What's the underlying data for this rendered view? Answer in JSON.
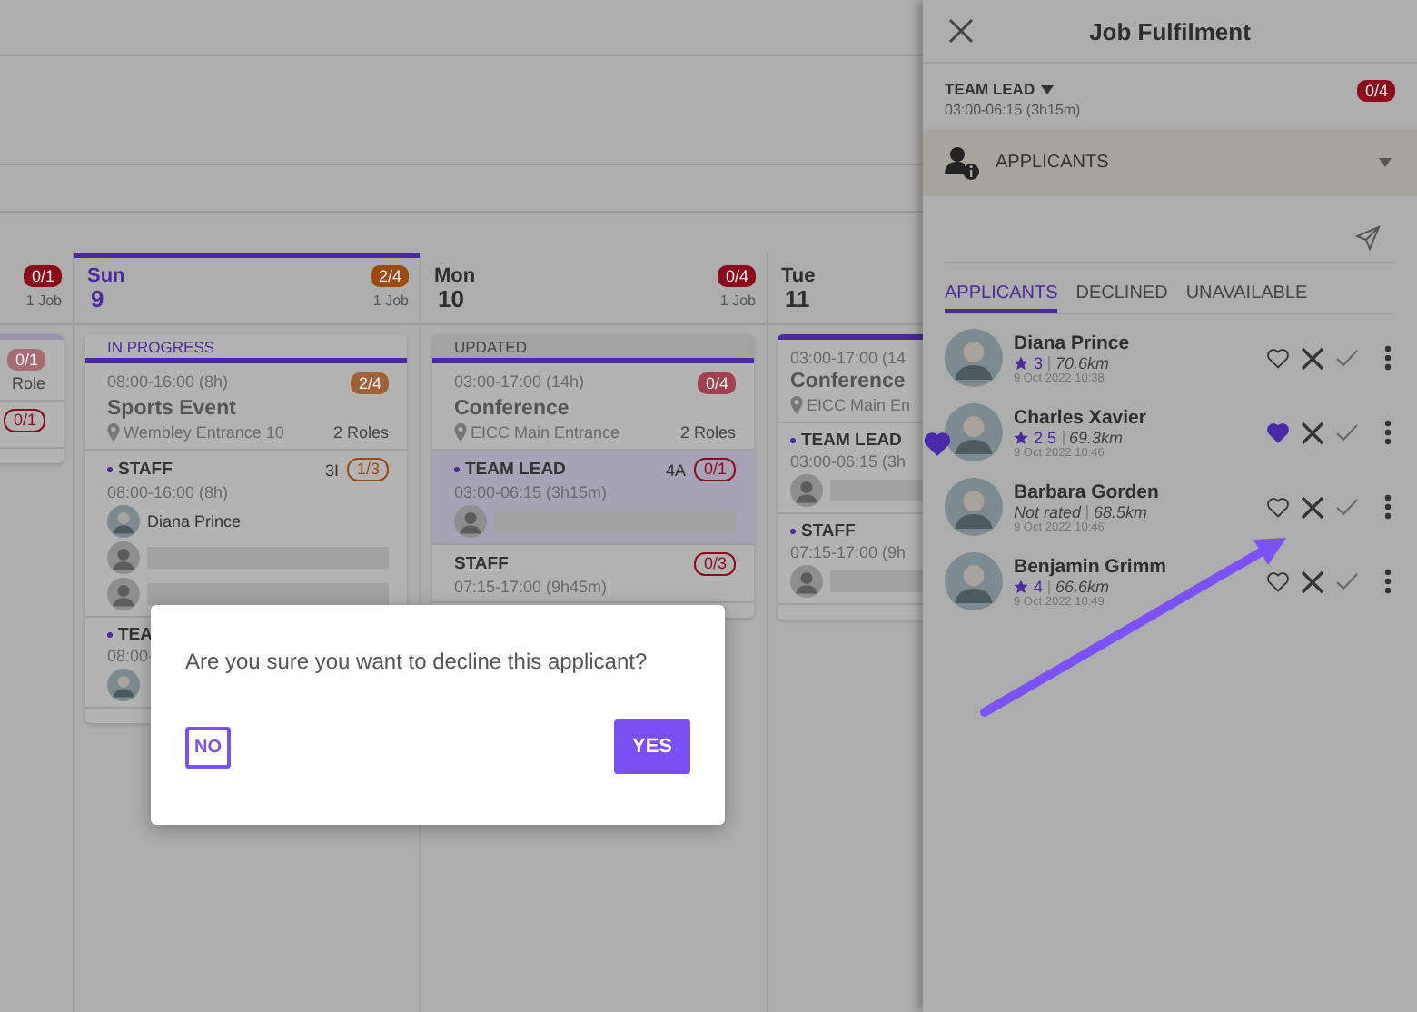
{
  "calendar": {
    "days": [
      {
        "badge": {
          "text": "0/1",
          "color": "#8c0a1a"
        },
        "jobs": "1 Job",
        "selected": false,
        "cards": [
          {
            "status": {
              "kind": "faded"
            },
            "badge": {
              "text": "0/1",
              "color": "#a86b74"
            },
            "roles_count": "Role",
            "roles": [
              {
                "selected": false,
                "badge": {
                  "text": "0/1",
                  "color": "#8c0a1a"
                },
                "slots": [
                  {
                    "kind": "bar"
                  }
                ]
              }
            ]
          }
        ]
      },
      {
        "weekday": "Sun",
        "day": "9",
        "badge": {
          "text": "2/4",
          "color": "#9c4a12"
        },
        "jobs": "1 Job",
        "selected": true,
        "cards": [
          {
            "status": {
              "kind": "progress",
              "text": "IN PROGRESS"
            },
            "time": "08:00-16:00 (8h)",
            "badge": {
              "text": "2/4",
              "color": "#a0603a"
            },
            "title": "Sports Event",
            "location": "Wembley Entrance 10",
            "roles_count": "2 Roles",
            "roles": [
              {
                "name": "STAFF",
                "marked": true,
                "selected": false,
                "code": "3I",
                "badge": {
                  "text": "1/3",
                  "color": "#9c4a12"
                },
                "time": "08:00-16:00 (8h)",
                "slots": [
                  {
                    "kind": "filled",
                    "name": "Diana Prince"
                  },
                  {
                    "kind": "empty"
                  },
                  {
                    "kind": "empty"
                  }
                ]
              },
              {
                "name": "TEA",
                "marked": true,
                "selected": false,
                "time": "08:00-",
                "slots": [
                  {
                    "kind": "filled"
                  }
                ]
              }
            ]
          }
        ]
      },
      {
        "weekday": "Mon",
        "day": "10",
        "badge": {
          "text": "0/4",
          "color": "#8c0a1a"
        },
        "jobs": "1 Job",
        "selected": false,
        "cards": [
          {
            "status": {
              "kind": "updated",
              "text": "UPDATED"
            },
            "time": "03:00-17:00 (14h)",
            "badge": {
              "text": "0/4",
              "color": "#a0414f"
            },
            "title": "Conference",
            "location": "EICC Main Entrance",
            "roles_count": "2 Roles",
            "roles": [
              {
                "name": "TEAM LEAD",
                "marked": true,
                "selected": true,
                "code": "4A",
                "badge": {
                  "text": "0/1",
                  "color": "#8c0a1a"
                },
                "time": "03:00-06:15 (3h15m)",
                "slots": [
                  {
                    "kind": "empty"
                  }
                ]
              },
              {
                "name": "STAFF",
                "marked": false,
                "selected": false,
                "badge": {
                  "text": "0/3",
                  "color": "#8c0a1a"
                },
                "time": "07:15-17:00 (9h45m)"
              }
            ]
          }
        ]
      },
      {
        "weekday": "Tue",
        "day": "11",
        "selected": false,
        "cards": [
          {
            "status": {
              "kind": "plain"
            },
            "time": "03:00-17:00 (14",
            "title": "Conference",
            "location": "EICC Main En",
            "roles": [
              {
                "name": "TEAM LEAD",
                "marked": true,
                "selected": false,
                "time": "03:00-06:15 (3h",
                "slots": [
                  {
                    "kind": "empty"
                  }
                ]
              },
              {
                "name": "STAFF",
                "marked": true,
                "selected": false,
                "time": "07:15-17:00 (9h",
                "slots": [
                  {
                    "kind": "empty"
                  }
                ]
              }
            ]
          }
        ]
      }
    ]
  },
  "panel": {
    "title": "Job Fulfilment",
    "role": {
      "name": "TEAM LEAD",
      "time": "03:00-06:15 (3h15m)",
      "badge": {
        "text": "0/4",
        "color": "#8c0a1a"
      }
    },
    "section": {
      "title": "APPLICANTS",
      "expanded": true
    },
    "tabs": [
      {
        "label": "APPLICANTS",
        "selected": true
      },
      {
        "label": "DECLINED",
        "selected": false
      },
      {
        "label": "UNAVAILABLE",
        "selected": false
      }
    ],
    "applicants": [
      {
        "name": "Diana Prince",
        "kind": "rated",
        "rating": "3",
        "distance": "70.6km",
        "date": "9 Oct 2022 10:38",
        "favorite": false
      },
      {
        "name": "Charles Xavier",
        "kind": "rated",
        "rating": "2.5",
        "distance": "69.3km",
        "date": "9 Oct 2022 10:46",
        "favorite": true
      },
      {
        "name": "Barbara Gorden",
        "kind": "unrated",
        "rating": "Not rated",
        "distance": "68.5km",
        "date": "9 Oct 2022 10:46",
        "favorite": false
      },
      {
        "name": "Benjamin Grimm",
        "kind": "rated",
        "rating": "4",
        "distance": "66.6km",
        "date": "9 Oct 2022 10:49",
        "favorite": false
      }
    ]
  },
  "dialog": {
    "message": "Are you sure you want to decline this applicant?",
    "buttons": [
      {
        "label": "NO",
        "kind": "secondary"
      },
      {
        "label": "YES",
        "kind": "primary"
      }
    ]
  }
}
